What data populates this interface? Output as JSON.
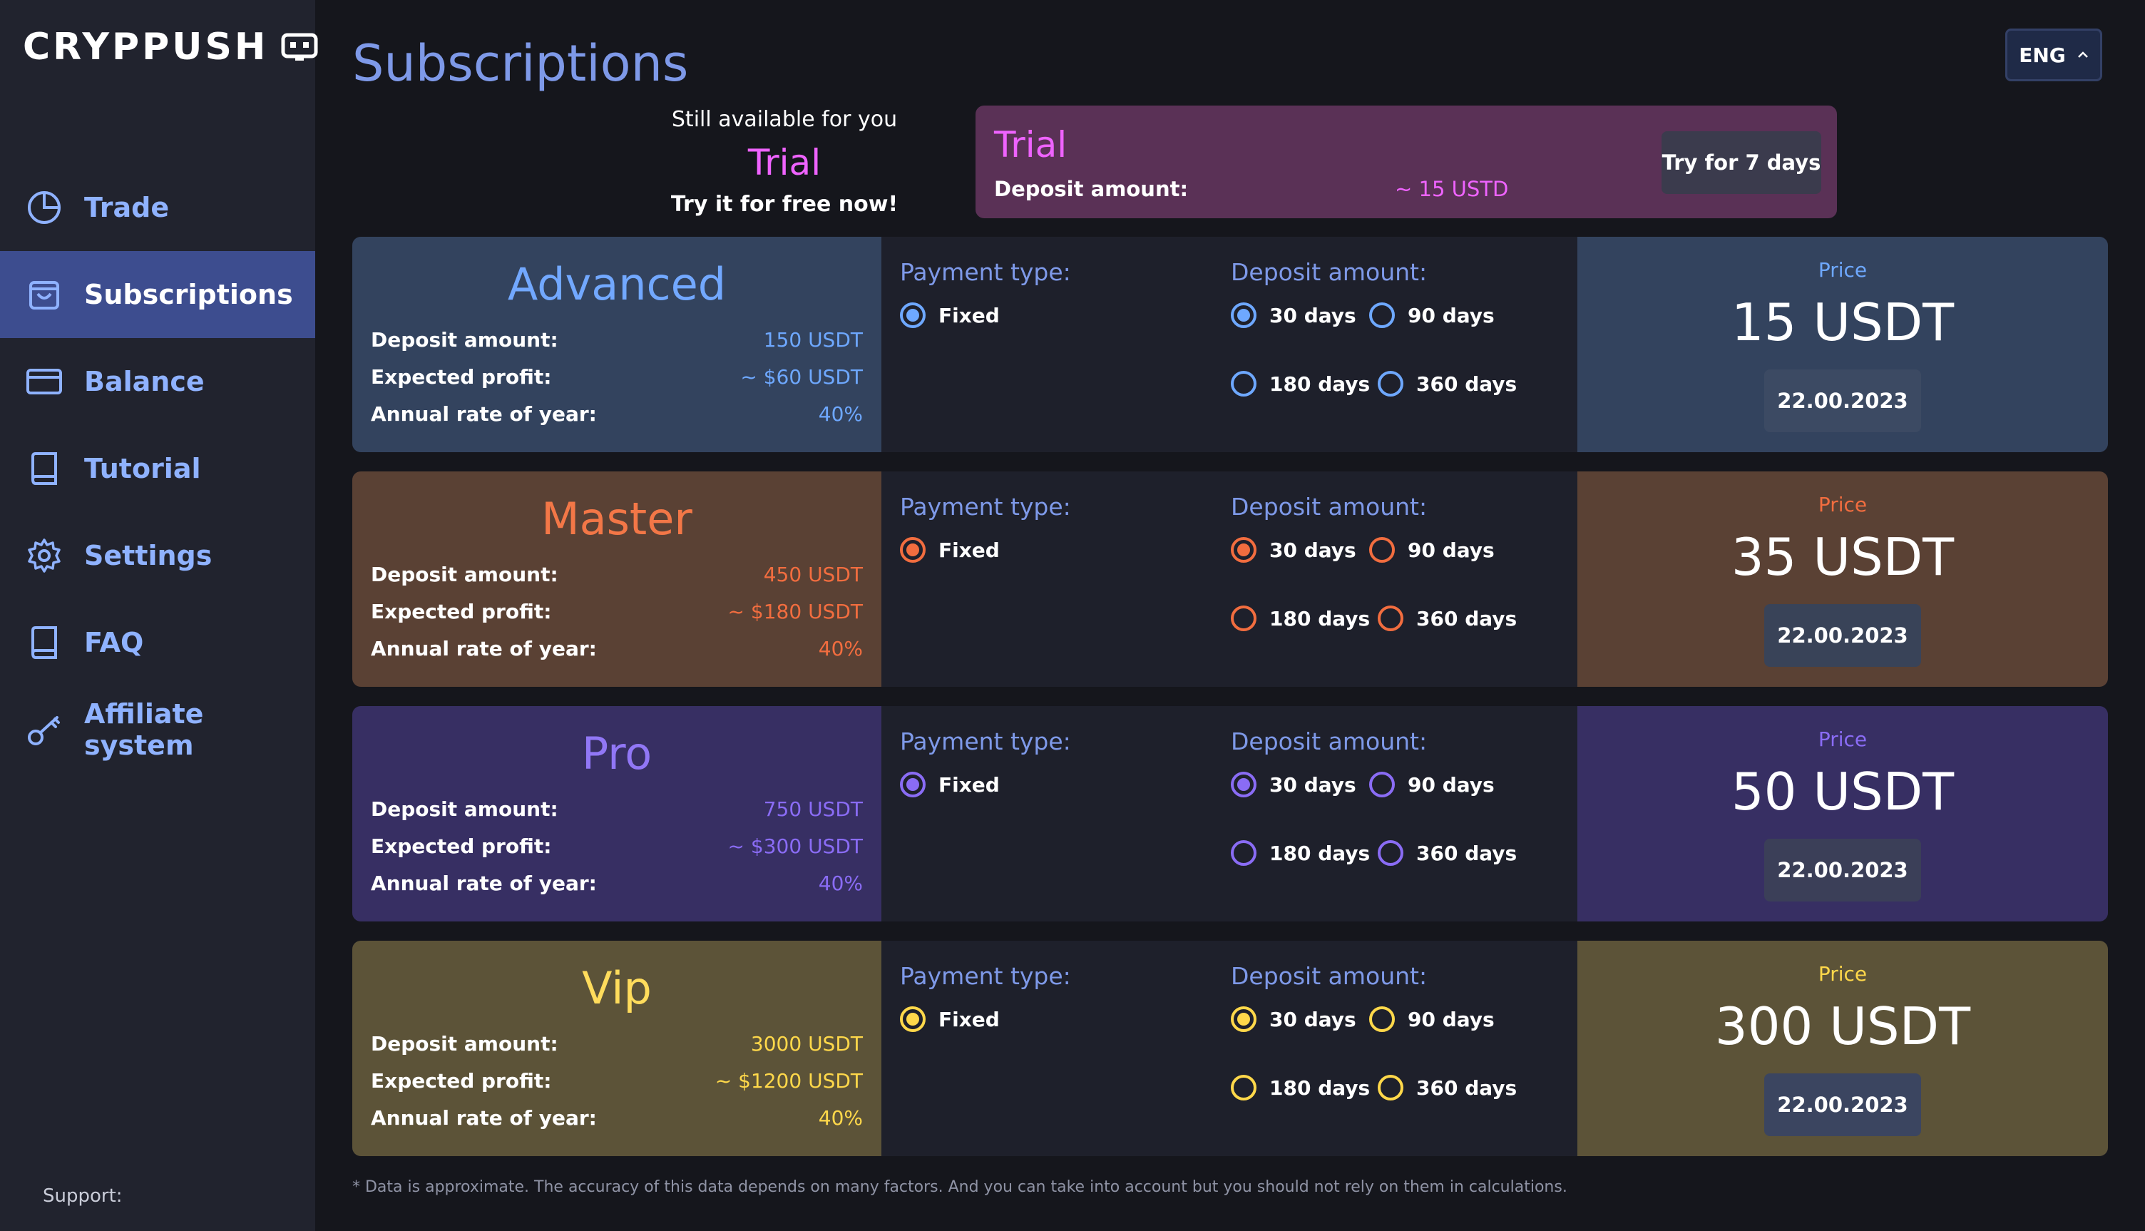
{
  "app": {
    "logo_text": "CRYPPUSH"
  },
  "sidebar": {
    "items": [
      {
        "label": "Trade",
        "icon": "pie-chart-icon"
      },
      {
        "label": "Subscriptions",
        "icon": "bag-icon",
        "active": true
      },
      {
        "label": "Balance",
        "icon": "card-icon"
      },
      {
        "label": "Tutorial",
        "icon": "book-icon"
      },
      {
        "label": "Settings",
        "icon": "gear-icon"
      },
      {
        "label": "FAQ",
        "icon": "book-icon"
      },
      {
        "label": "Affiliate system",
        "icon": "key-icon"
      }
    ],
    "support_label": "Support:"
  },
  "header": {
    "title": "Subscriptions",
    "language": "ENG"
  },
  "trial_promo": {
    "line1": "Still available for you",
    "name": "Trial",
    "line3": "Try it for free now!"
  },
  "trial_card": {
    "name": "Trial",
    "deposit_label": "Deposit amount:",
    "deposit_value": "~ 15 USTD",
    "button": "Try for 7 days"
  },
  "labels": {
    "deposit_amount": "Deposit amount:",
    "expected_profit": "Expected profit:",
    "annual_rate": "Annual rate of year:",
    "payment_type": "Payment type:",
    "deposit_amount_title": "Deposit amount:",
    "fixed": "Fixed",
    "d30": "30 days",
    "d90": "90 days",
    "d180": "180 days",
    "d360": "360 days",
    "price": "Price"
  },
  "plans": [
    {
      "name": "Advanced",
      "deposit": "150 USDT",
      "profit": "~ $60 USDT",
      "rate": "40%",
      "price": "15 USDT",
      "date": "22.00.2023",
      "accent": "#6ea8ff"
    },
    {
      "name": "Master",
      "deposit": "450 USDT",
      "profit": "~ $180 USDT",
      "rate": "40%",
      "price": "35 USDT",
      "date": "22.00.2023",
      "accent": "#f26d3f"
    },
    {
      "name": "Pro",
      "deposit": "750 USDT",
      "profit": "~ $300 USDT",
      "rate": "40%",
      "price": "50 USDT",
      "date": "22.00.2023",
      "accent": "#8a6cf5"
    },
    {
      "name": "Vip",
      "deposit": "3000 USDT",
      "profit": "~ $1200 USDT",
      "rate": "40%",
      "price": "300 USDT",
      "date": "22.00.2023",
      "accent": "#ffd84a"
    }
  ],
  "footnote": "* Data is approximate. The accuracy of this data depends on many factors. And you can take into account but you should not rely on them in calculations."
}
